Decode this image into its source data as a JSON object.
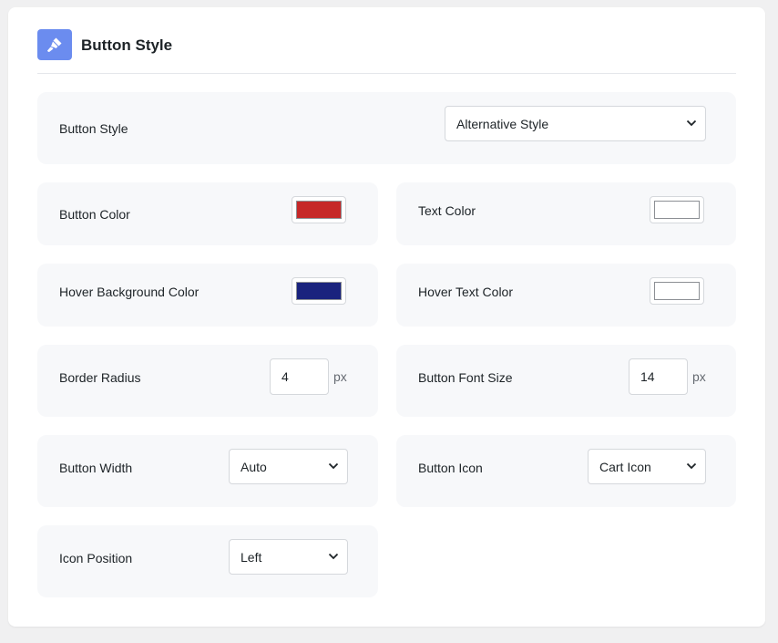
{
  "header": {
    "title": "Button Style",
    "icon": "paintbrush-icon",
    "icon_bg": "#6b8cef"
  },
  "button_style": {
    "label": "Button Style",
    "value": "Alternative Style"
  },
  "button_color": {
    "label": "Button Color",
    "color": "#c62828"
  },
  "text_color": {
    "label": "Text Color",
    "color": "#ffffff"
  },
  "hover_bg_color": {
    "label": "Hover Background Color",
    "color": "#1a237e"
  },
  "hover_text_color": {
    "label": "Hover Text Color",
    "color": "#ffffff"
  },
  "border_radius": {
    "label": "Border Radius",
    "value": "4",
    "unit": "px"
  },
  "font_size": {
    "label": "Button Font Size",
    "value": "14",
    "unit": "px"
  },
  "button_width": {
    "label": "Button Width",
    "value": "Auto"
  },
  "button_icon": {
    "label": "Button Icon",
    "value": "Cart Icon"
  },
  "icon_position": {
    "label": "Icon Position",
    "value": "Left"
  }
}
